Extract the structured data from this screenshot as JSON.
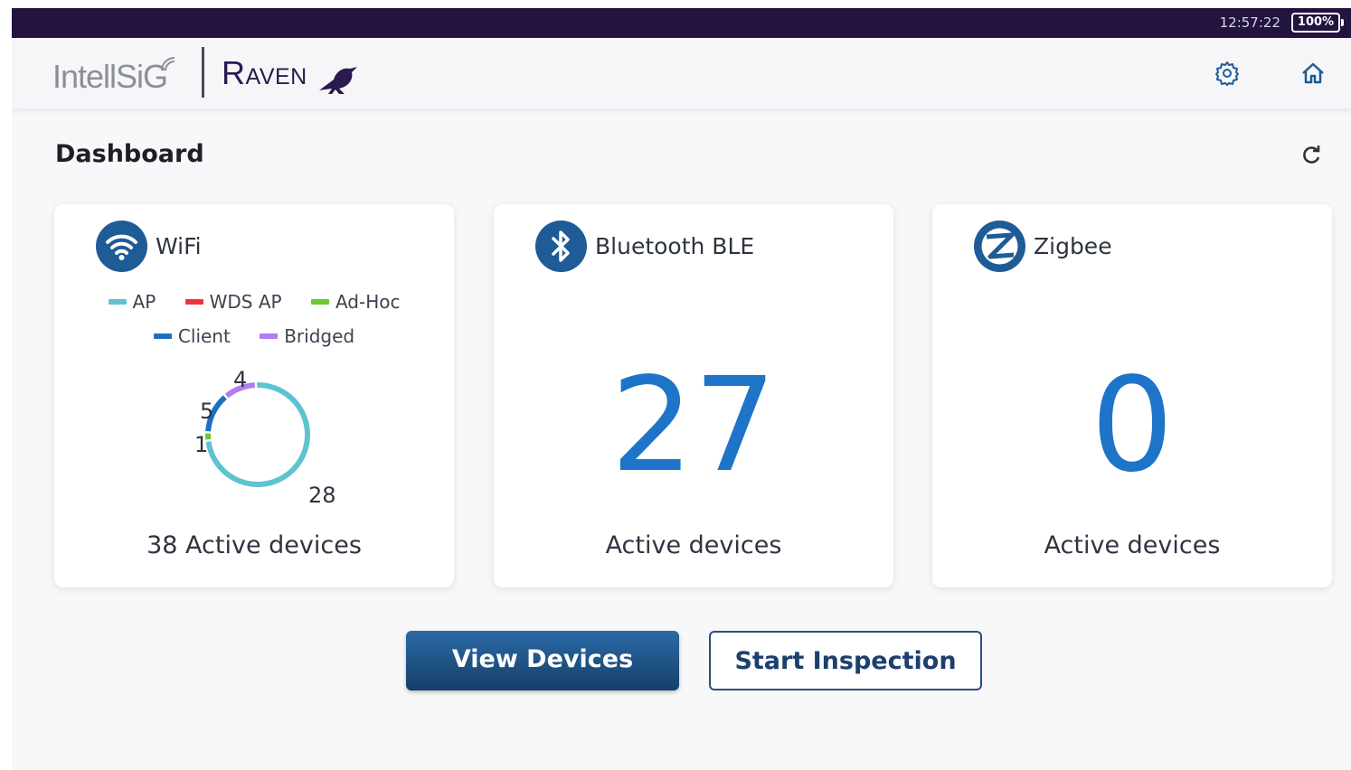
{
  "status_bar": {
    "time": "12:57:22",
    "battery": "100%"
  },
  "header": {
    "brand_left": "IntellSiG",
    "brand_right": "Raven",
    "settings_icon": "gear-icon",
    "home_icon": "home-icon"
  },
  "page": {
    "title": "Dashboard",
    "refresh_icon": "refresh-icon"
  },
  "cards": {
    "wifi": {
      "title": "WiFi",
      "icon": "wifi-icon",
      "legend": [
        {
          "label": "AP",
          "color": "#5ec3d0"
        },
        {
          "label": "WDS AP",
          "color": "#f0323c"
        },
        {
          "label": "Ad-Hoc",
          "color": "#6cc832"
        },
        {
          "label": "Client",
          "color": "#1e6fc4"
        },
        {
          "label": "Bridged",
          "color": "#b07ef0"
        }
      ],
      "footer": "38 Active devices"
    },
    "bluetooth": {
      "title": "Bluetooth BLE",
      "icon": "bluetooth-icon",
      "count": "27",
      "footer": "Active devices"
    },
    "zigbee": {
      "title": "Zigbee",
      "icon": "zigbee-icon",
      "count": "0",
      "footer": "Active devices"
    }
  },
  "chart_data": {
    "type": "pie",
    "categories": [
      "AP",
      "WDS AP",
      "Ad-Hoc",
      "Client",
      "Bridged"
    ],
    "values": [
      28,
      0,
      1,
      5,
      4
    ],
    "data_labels": [
      "28",
      "1",
      "5",
      "4"
    ],
    "colors": [
      "#5ec3d0",
      "#f0323c",
      "#6cc832",
      "#1e6fc4",
      "#b07ef0"
    ],
    "legend": "top"
  },
  "buttons": {
    "view_devices": "View Devices",
    "start_inspection": "Start Inspection"
  }
}
